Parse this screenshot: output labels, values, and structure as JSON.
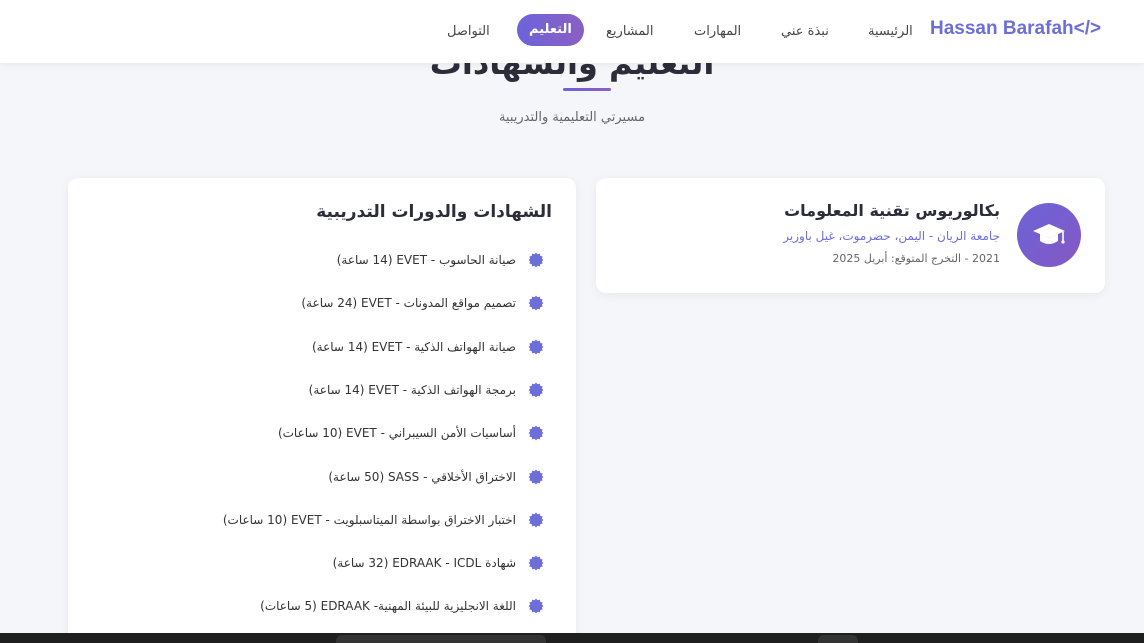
{
  "nav": {
    "brand": "Hassan Barafah</>",
    "items": [
      {
        "label": "الرئيسية"
      },
      {
        "label": "نبذة عني"
      },
      {
        "label": "المهارات"
      },
      {
        "label": "المشاريع"
      },
      {
        "label": "التعليم",
        "active": true
      },
      {
        "label": "التواصل"
      }
    ]
  },
  "section": {
    "title": "التعليم والشهادات",
    "subtitle": "مسيرتي التعليمية والتدريبية"
  },
  "degree": {
    "icon": "graduation-cap-icon",
    "title": "بكالوريوس تقنية المعلومات",
    "university": "جامعة الريان - اليمن، حضرموت، غيل باوزير",
    "dates": "2021 - التخرج المتوقع: أبريل 2025"
  },
  "certificates": {
    "title": "الشهادات والدورات التدريبية",
    "icon": "certificate-badge-icon",
    "items": [
      "صيانة الحاسوب - EVET (14 ساعة)",
      "تصميم مواقع المدونات - EVET (24 ساعة)",
      "صيانة الهواتف الذكية - EVET (14 ساعة)",
      "برمجة الهواتف الذكية - EVET (14 ساعة)",
      "أساسيات الأمن السيبراني - EVET (10 ساعات)",
      "الاختراق الأخلاقي - SASS (50 ساعة)",
      "اختبار الاختراق بواسطة الميتاسبلويت - EVET (10 ساعات)",
      "شهادة EDRAAK - ICDL (32 ساعة)",
      "اللغة الانجليزية للبيئة المهنية- EDRAAK (5 ساعات)"
    ]
  },
  "colors": {
    "accent": "#6c63d9",
    "accent_secondary": "#8b5fc4",
    "brand": "#6c6fd8"
  }
}
